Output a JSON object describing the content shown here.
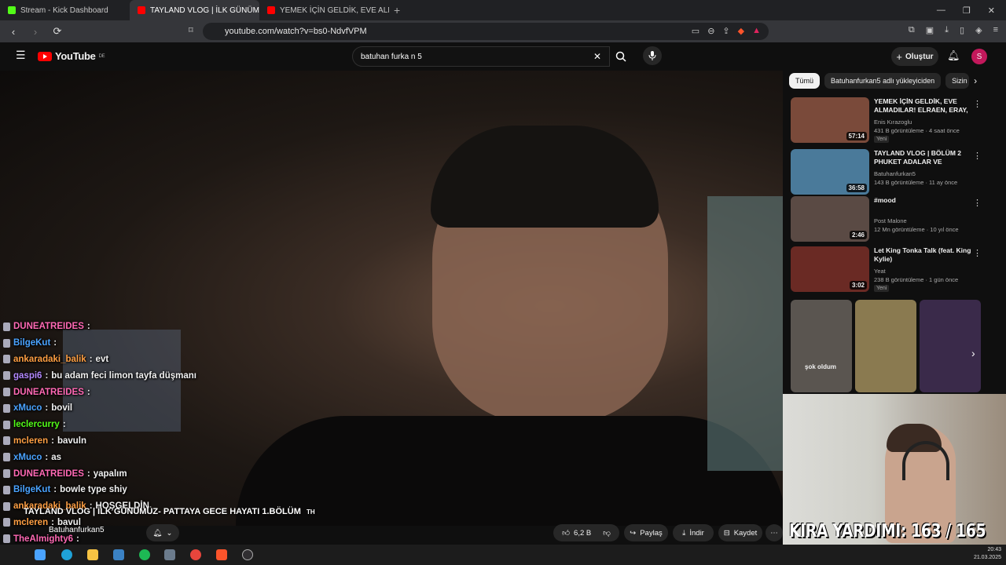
{
  "browser": {
    "tabs": [
      {
        "title": "Stream - Kick Dashboard",
        "color": "#53fc18"
      },
      {
        "title": "TAYLAND VLOG | İLK GÜNÜMÜZ",
        "color": "#ff0000"
      },
      {
        "title": "YEMEK İÇİN GELDİK, EVE ALMADILAR",
        "color": "#ff0000"
      }
    ],
    "url": "youtube.com/watch?v=bs0-NdvfVPM"
  },
  "youtube": {
    "logo": "YouTube",
    "region": "DE",
    "search_value": "batuhan furka n 5",
    "create_label": "Oluştur",
    "avatar_letter": "S"
  },
  "video": {
    "title_overlay": "TAYLAND VLOG | İLK GÜNÜMÜZ- PATTAYA GECE HAYATI 1.BÖLÜM",
    "title_suffix": "TH",
    "channel": "Batuhanfurkan5",
    "like_count": "6,2 B",
    "share_label": "Paylaş",
    "download_label": "İndir",
    "save_label": "Kaydet"
  },
  "chat": [
    {
      "user": "DUNEATREIDES",
      "msg": "",
      "color": "#ff69b4"
    },
    {
      "user": "BilgeKut",
      "msg": "",
      "color": "#4aa3ff"
    },
    {
      "user": "ankaradaki_balik",
      "msg": "evt",
      "color": "#ff9f43"
    },
    {
      "user": "gaspi6",
      "msg": "bu adam feci limon tayfa düşmanı",
      "color": "#b388ff"
    },
    {
      "user": "DUNEATREIDES",
      "msg": "",
      "color": "#ff69b4"
    },
    {
      "user": "xMuco",
      "msg": "bovil",
      "color": "#4aa3ff"
    },
    {
      "user": "leclercurry",
      "msg": "",
      "color": "#53fc18"
    },
    {
      "user": "mcleren",
      "msg": "bavuln",
      "color": "#ff9f43"
    },
    {
      "user": "xMuco",
      "msg": "as",
      "color": "#4aa3ff"
    },
    {
      "user": "DUNEATREIDES",
      "msg": "yapalım",
      "color": "#ff69b4"
    },
    {
      "user": "BilgeKut",
      "msg": "bowle type shiy",
      "color": "#4aa3ff"
    },
    {
      "user": "ankaradaki_balik",
      "msg": "HOŞGELDİN",
      "color": "#ff9f43"
    },
    {
      "user": "mcleren",
      "msg": "bavul",
      "color": "#ff9f43"
    },
    {
      "user": "TheAlmighty6",
      "msg": "",
      "color": "#ff69b4"
    }
  ],
  "chat_partial": {
    "user": "eren",
    "msg": "bavul"
  },
  "sidebar": {
    "chips": [
      "Tümü",
      "Batuhanfurkan5 adlı yükleyiciden",
      "Sizin"
    ],
    "recommendations": [
      {
        "title": "YEMEK İÇİN GELDİK, EVE ALMADILAR! ELRAEN, ERAY, ...",
        "channel": "Enis Kırazoglu",
        "meta": "431 B görüntüleme · 4 saat önce",
        "duration": "57:14",
        "badge": "Yeni",
        "thumb": "#7a4a3a"
      },
      {
        "title": "TAYLAND VLOG | BÖLÜM 2 PHUKET ADALAR VE PHUKET...",
        "channel": "Batuhanfurkan5",
        "meta": "143 B görüntüleme · 11 ay önce",
        "duration": "36:58",
        "badge": "",
        "thumb": "#4a7a9a"
      },
      {
        "title": "#mood",
        "channel": "Post Malone",
        "meta": "12 Mn görüntüleme · 10 yıl önce",
        "duration": "2:46",
        "badge": "",
        "thumb": "#5a4a44"
      },
      {
        "title": "Let King Tonka Talk (feat. King Kylie)",
        "channel": "Yeat",
        "meta": "238 B görüntüleme · 1 gün önce",
        "duration": "3:02",
        "badge": "Yeni",
        "thumb": "#6a2a24"
      }
    ],
    "shorts": [
      {
        "label": "şok oldum",
        "color": "#5a5550"
      },
      {
        "label": "",
        "color": "#8a7a50"
      },
      {
        "label": "",
        "color": "#3a2a4a"
      }
    ]
  },
  "overlay": {
    "kira": "KIRA YARDIMI: 163 / 165"
  },
  "clock": {
    "time": "20:43",
    "date": "21.03.2025"
  }
}
